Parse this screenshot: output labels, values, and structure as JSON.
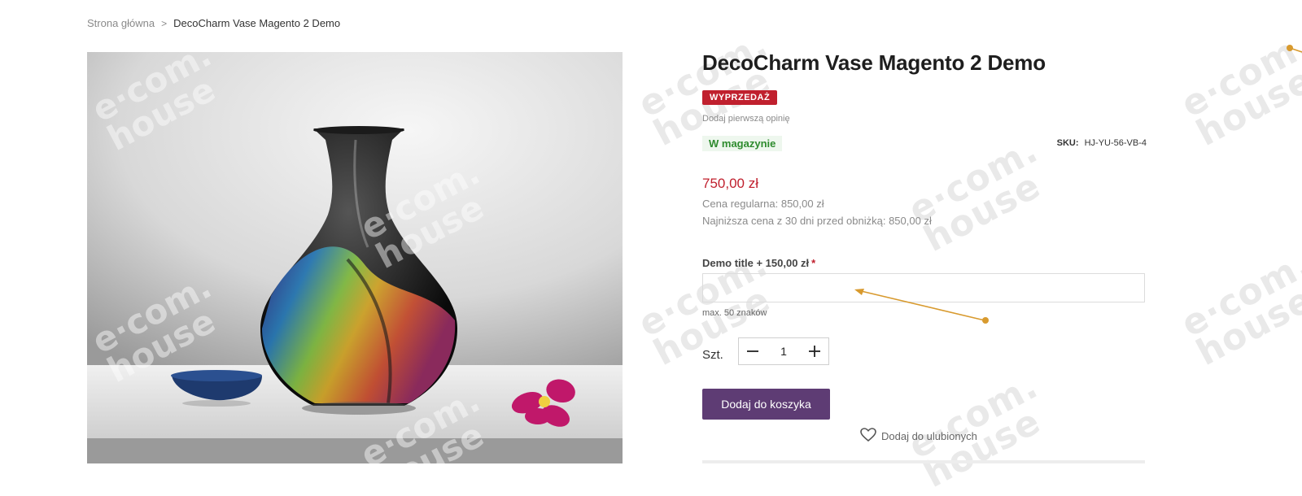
{
  "breadcrumb": {
    "home": "Strona główna",
    "separator": ">",
    "current": "DecoCharm Vase Magento 2 Demo"
  },
  "watermark": {
    "text_line1": "e·com.",
    "text_line2": "house"
  },
  "product": {
    "title": "DecoCharm Vase Magento 2 Demo",
    "sale_badge": "WYPRZEDAŻ",
    "review_link": "Dodaj pierwszą opinię",
    "stock": "W magazynie",
    "sku_label": "SKU:",
    "sku_value": "HJ-YU-56-VB-4",
    "price": "750,00 zł",
    "regular_price": "Cena regularna: 850,00 zł",
    "lowest_price": "Najniższa cena z 30 dni przed obniżką: 850,00 zł"
  },
  "custom_option": {
    "label": "Demo title + 150,00 zł",
    "required_mark": "*",
    "value": "",
    "hint": "max. 50 znaków"
  },
  "quantity": {
    "label": "Szt.",
    "value": "1",
    "minus_icon": "minus-icon",
    "plus_icon": "plus-icon"
  },
  "actions": {
    "add_to_cart": "Dodaj do koszyka",
    "wishlist": "Dodaj do ulubionych",
    "wishlist_icon": "heart-icon"
  },
  "colors": {
    "sale": "#c0202e",
    "stock": "#2e8b2e",
    "primary_button": "#5e3c74",
    "annotation": "#d89a2e"
  }
}
